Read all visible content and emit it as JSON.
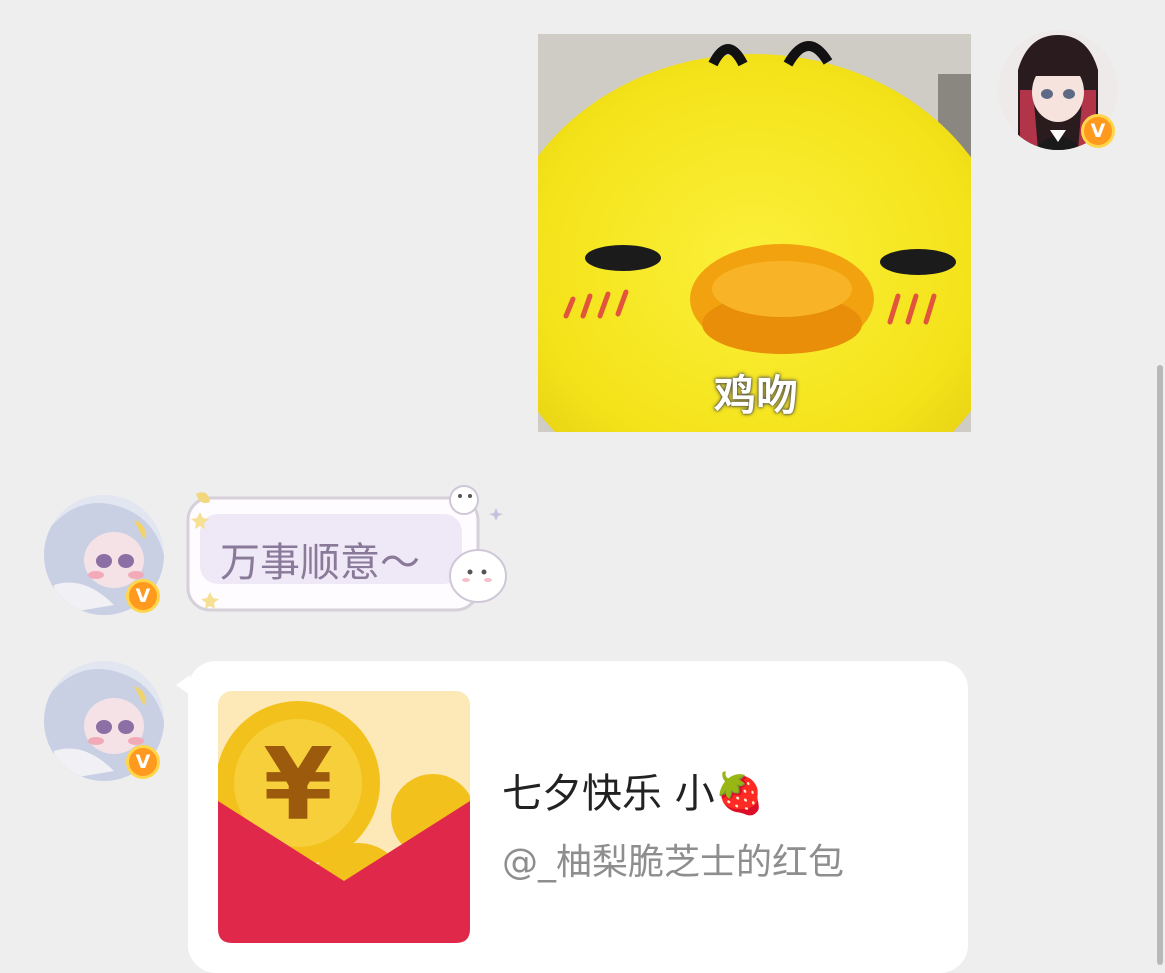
{
  "messages": {
    "sticker": {
      "caption": "鸡吻"
    },
    "greeting": {
      "text": "万事顺意～"
    },
    "red_packet": {
      "title": "七夕快乐 小🍓",
      "sender": "@_柚梨脆芝士的红包"
    }
  },
  "badges": {
    "vip_letter": "V"
  },
  "colors": {
    "background": "#eeeeee",
    "badge": "#ff9a1f",
    "red_packet": "#e0294a",
    "coin": "#f3c11b",
    "bubble_text": "#8a7a9a",
    "sender_text": "#8e8e8e"
  }
}
